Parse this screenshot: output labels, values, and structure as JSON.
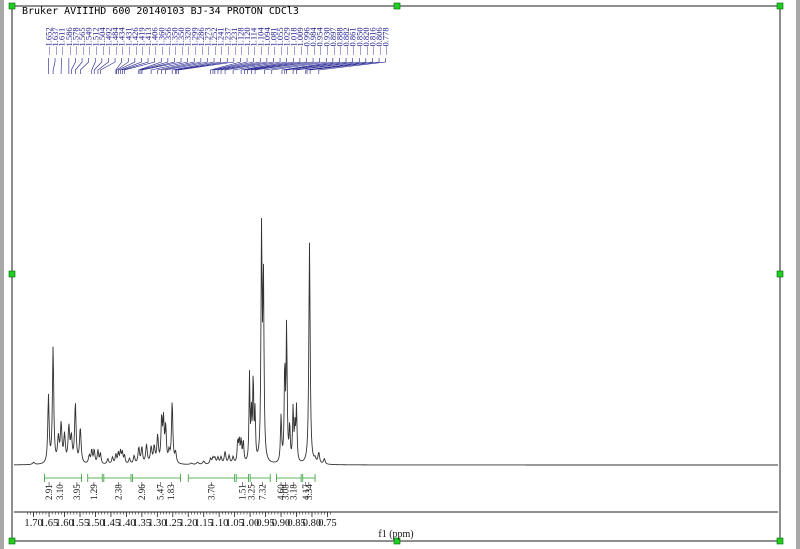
{
  "header": {
    "title": "Bruker AVIIIHD 600 20140103 BJ-34 PROTON CDCl3"
  },
  "chart_data": {
    "type": "line",
    "title": "Bruker AVIIIHD 600 20140103 BJ-34 PROTON CDCl3",
    "xlabel": "f1 (ppm)",
    "xlim": [
      1.72,
      0.74
    ],
    "x_reversed": true,
    "x_ticks": [
      1.7,
      1.65,
      1.6,
      1.55,
      1.5,
      1.45,
      1.4,
      1.35,
      1.3,
      1.25,
      1.2,
      1.15,
      1.1,
      1.05,
      1.0,
      0.95,
      0.9,
      0.85,
      0.8,
      0.75
    ],
    "x_tick_labels": [
      "1.70",
      "1.65",
      "1.60",
      "1.55",
      "1.50",
      "1.45",
      "1.40",
      "1.35",
      "1.30",
      "1.25",
      "1.20",
      "1.15",
      "1.10",
      "1.05",
      "1.00",
      "0.95",
      "0.90",
      "0.85",
      "0.80",
      "0.75"
    ],
    "peak_labels": [
      "1.652",
      "1.637",
      "1.611",
      "1.586",
      "1.578",
      "1.565",
      "1.549",
      "1.512",
      "1.504",
      "1.492",
      "1.484",
      "1.434",
      "1.431",
      "1.426",
      "1.419",
      "1.413",
      "1.406",
      "1.360",
      "1.356",
      "1.350",
      "1.350",
      "1.320",
      "1.299",
      "1.286",
      "1.273",
      "1.252",
      "1.241",
      "1.237",
      "1.231",
      "1.128",
      "1.120",
      "1.114",
      "1.104",
      "1.094",
      "1.081",
      "1.055",
      "1.029",
      "1.018",
      "1.009",
      "0.996",
      "0.984",
      "0.954",
      "0.930",
      "0.897",
      "0.888",
      "0.882",
      "0.861",
      "0.850",
      "0.820",
      "0.816",
      "0.806",
      "0.778"
    ],
    "integrals": [
      {
        "from": 1.665,
        "to": 1.545,
        "values": [
          "2.91",
          "3.10",
          "3.95"
        ],
        "value_ppm": [
          1.65,
          1.615,
          1.56
        ]
      },
      {
        "from": 1.525,
        "to": 1.478,
        "values": [
          "1.29"
        ],
        "value_ppm": [
          1.505
        ]
      },
      {
        "from": 1.473,
        "to": 1.385,
        "values": [
          "2.38"
        ],
        "value_ppm": [
          1.425
        ]
      },
      {
        "from": 1.38,
        "to": 1.225,
        "values": [
          "2.96",
          "5.47",
          "1.83"
        ],
        "value_ppm": [
          1.35,
          1.29,
          1.255
        ]
      },
      {
        "from": 1.2,
        "to": 1.05,
        "values": [
          "3.70"
        ],
        "value_ppm": [
          1.125
        ]
      },
      {
        "from": 1.045,
        "to": 1.005,
        "values": [
          "1.51"
        ],
        "value_ppm": [
          1.025
        ]
      },
      {
        "from": 1.0,
        "to": 0.935,
        "values": [
          "3.25",
          "7.32"
        ],
        "value_ppm": [
          0.995,
          0.96
        ]
      },
      {
        "from": 0.915,
        "to": 0.835,
        "values": [
          "4.60",
          "3.08",
          "3.18"
        ],
        "value_ppm": [
          0.9,
          0.885,
          0.86
        ]
      },
      {
        "from": 0.83,
        "to": 0.79,
        "values": [
          "4.17",
          "3.34"
        ],
        "value_ppm": [
          0.82,
          0.81
        ]
      }
    ],
    "peaks": [
      {
        "ppm": 1.7,
        "h": 0.008,
        "w": 0.004
      },
      {
        "ppm": 1.652,
        "h": 0.25,
        "w": 0.0025
      },
      {
        "ppm": 1.637,
        "h": 0.43,
        "w": 0.0025
      },
      {
        "ppm": 1.62,
        "h": 0.09,
        "w": 0.003
      },
      {
        "ppm": 1.611,
        "h": 0.14,
        "w": 0.003
      },
      {
        "ppm": 1.6,
        "h": 0.1,
        "w": 0.003
      },
      {
        "ppm": 1.586,
        "h": 0.13,
        "w": 0.003
      },
      {
        "ppm": 1.578,
        "h": 0.09,
        "w": 0.003
      },
      {
        "ppm": 1.565,
        "h": 0.22,
        "w": 0.0028
      },
      {
        "ppm": 1.549,
        "h": 0.13,
        "w": 0.003
      },
      {
        "ppm": 1.52,
        "h": 0.03,
        "w": 0.003
      },
      {
        "ppm": 1.512,
        "h": 0.05,
        "w": 0.0025
      },
      {
        "ppm": 1.504,
        "h": 0.05,
        "w": 0.0025
      },
      {
        "ppm": 1.492,
        "h": 0.05,
        "w": 0.0025
      },
      {
        "ppm": 1.484,
        "h": 0.04,
        "w": 0.0025
      },
      {
        "ppm": 1.46,
        "h": 0.02,
        "w": 0.003
      },
      {
        "ppm": 1.445,
        "h": 0.025,
        "w": 0.003
      },
      {
        "ppm": 1.434,
        "h": 0.035,
        "w": 0.0025
      },
      {
        "ppm": 1.426,
        "h": 0.04,
        "w": 0.0025
      },
      {
        "ppm": 1.419,
        "h": 0.045,
        "w": 0.0025
      },
      {
        "ppm": 1.413,
        "h": 0.04,
        "w": 0.0025
      },
      {
        "ppm": 1.406,
        "h": 0.03,
        "w": 0.0025
      },
      {
        "ppm": 1.39,
        "h": 0.02,
        "w": 0.003
      },
      {
        "ppm": 1.375,
        "h": 0.03,
        "w": 0.003
      },
      {
        "ppm": 1.36,
        "h": 0.06,
        "w": 0.0028
      },
      {
        "ppm": 1.35,
        "h": 0.06,
        "w": 0.0028
      },
      {
        "ppm": 1.335,
        "h": 0.07,
        "w": 0.003
      },
      {
        "ppm": 1.32,
        "h": 0.06,
        "w": 0.003
      },
      {
        "ppm": 1.31,
        "h": 0.06,
        "w": 0.003
      },
      {
        "ppm": 1.299,
        "h": 0.1,
        "w": 0.0028
      },
      {
        "ppm": 1.286,
        "h": 0.16,
        "w": 0.0025
      },
      {
        "ppm": 1.28,
        "h": 0.15,
        "w": 0.0025
      },
      {
        "ppm": 1.273,
        "h": 0.13,
        "w": 0.0025
      },
      {
        "ppm": 1.262,
        "h": 0.04,
        "w": 0.003
      },
      {
        "ppm": 1.252,
        "h": 0.23,
        "w": 0.0025
      },
      {
        "ppm": 1.241,
        "h": 0.04,
        "w": 0.003
      },
      {
        "ppm": 1.19,
        "h": 0.005,
        "w": 0.004
      },
      {
        "ppm": 1.17,
        "h": 0.008,
        "w": 0.004
      },
      {
        "ppm": 1.15,
        "h": 0.012,
        "w": 0.004
      },
      {
        "ppm": 1.128,
        "h": 0.02,
        "w": 0.003
      },
      {
        "ppm": 1.12,
        "h": 0.022,
        "w": 0.003
      },
      {
        "ppm": 1.114,
        "h": 0.022,
        "w": 0.003
      },
      {
        "ppm": 1.104,
        "h": 0.024,
        "w": 0.003
      },
      {
        "ppm": 1.094,
        "h": 0.025,
        "w": 0.003
      },
      {
        "ppm": 1.081,
        "h": 0.045,
        "w": 0.003
      },
      {
        "ppm": 1.068,
        "h": 0.03,
        "w": 0.003
      },
      {
        "ppm": 1.055,
        "h": 0.025,
        "w": 0.003
      },
      {
        "ppm": 1.04,
        "h": 0.08,
        "w": 0.0022
      },
      {
        "ppm": 1.035,
        "h": 0.08,
        "w": 0.0022
      },
      {
        "ppm": 1.029,
        "h": 0.08,
        "w": 0.0022
      },
      {
        "ppm": 1.022,
        "h": 0.08,
        "w": 0.0022
      },
      {
        "ppm": 1.002,
        "h": 0.32,
        "w": 0.0018
      },
      {
        "ppm": 0.996,
        "h": 0.18,
        "w": 0.0018
      },
      {
        "ppm": 0.99,
        "h": 0.32,
        "w": 0.0018
      },
      {
        "ppm": 0.984,
        "h": 0.18,
        "w": 0.0018
      },
      {
        "ppm": 0.963,
        "h": 0.84,
        "w": 0.0022
      },
      {
        "ppm": 0.957,
        "h": 0.66,
        "w": 0.0022
      },
      {
        "ppm": 0.9,
        "h": 0.17,
        "w": 0.0022
      },
      {
        "ppm": 0.888,
        "h": 0.35,
        "w": 0.002
      },
      {
        "ppm": 0.882,
        "h": 0.5,
        "w": 0.002
      },
      {
        "ppm": 0.872,
        "h": 0.13,
        "w": 0.002
      },
      {
        "ppm": 0.861,
        "h": 0.2,
        "w": 0.002
      },
      {
        "ppm": 0.855,
        "h": 0.12,
        "w": 0.002
      },
      {
        "ppm": 0.85,
        "h": 0.2,
        "w": 0.002
      },
      {
        "ppm": 0.808,
        "h": 0.82,
        "w": 0.0025
      },
      {
        "ppm": 0.79,
        "h": 0.015,
        "w": 0.003
      },
      {
        "ppm": 0.778,
        "h": 0.04,
        "w": 0.003
      },
      {
        "ppm": 0.76,
        "h": 0.02,
        "w": 0.003
      }
    ]
  }
}
